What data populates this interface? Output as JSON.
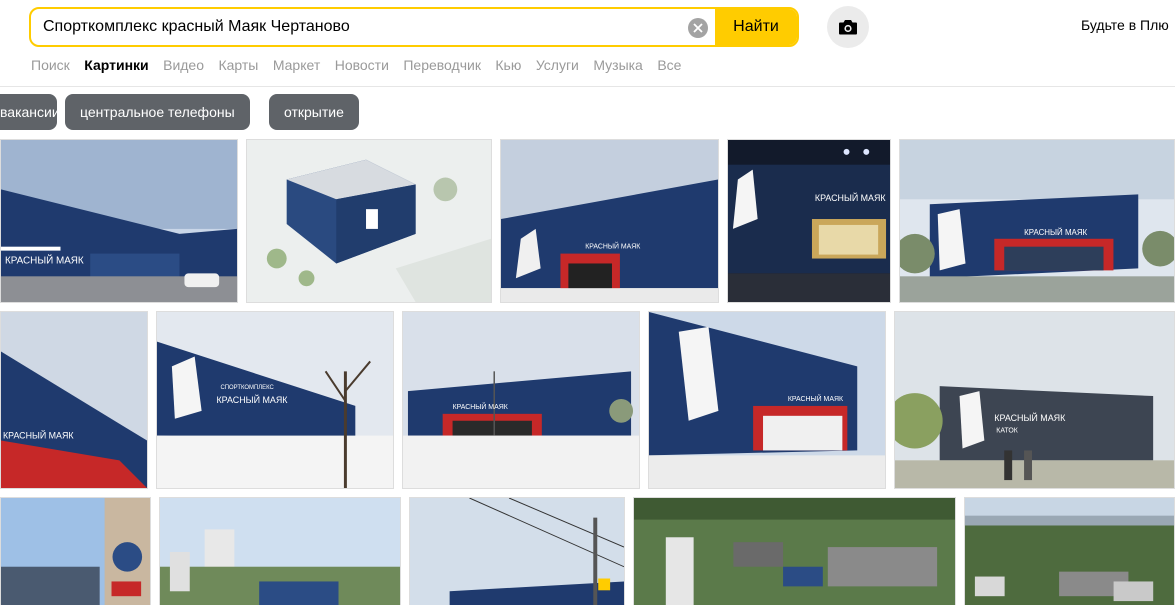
{
  "search": {
    "query": "Спорткомплекс красный Маяк Чертаново",
    "find_label": "Найти"
  },
  "header": {
    "plus_link": "Будьте в Плю"
  },
  "tabs": [
    {
      "label": "Поиск"
    },
    {
      "label": "Картинки",
      "active": true
    },
    {
      "label": "Видео"
    },
    {
      "label": "Карты"
    },
    {
      "label": "Маркет"
    },
    {
      "label": "Новости"
    },
    {
      "label": "Переводчик"
    },
    {
      "label": "Кью"
    },
    {
      "label": "Услуги"
    },
    {
      "label": "Музыка"
    },
    {
      "label": "Все"
    }
  ],
  "suggestions": [
    {
      "label": "вакансии"
    },
    {
      "label": "центральное телефоны"
    },
    {
      "label": "открытие"
    }
  ],
  "images": {
    "caption_brand": "КРАСНЫЙ МАЯК",
    "caption_rink": "КАТОК",
    "caption_sport": "СПОРТКОМПЛЕКС"
  },
  "colors": {
    "accent": "#ffcc00",
    "chip_bg": "#5f6368",
    "building_blue": "#1f3a6e",
    "building_red": "#c62828"
  }
}
